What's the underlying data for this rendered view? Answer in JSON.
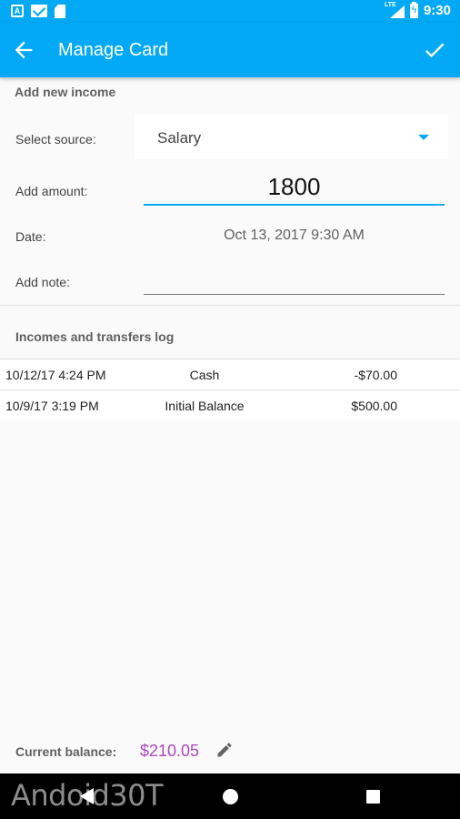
{
  "status_bar": {
    "time": "9:30",
    "network": "LTE",
    "left_icons": [
      "a-box-icon",
      "mail-icon",
      "sd-card-icon"
    ],
    "right_icons": [
      "signal-icon",
      "battery-charging-icon"
    ],
    "color": "#03a9f4"
  },
  "app_bar": {
    "title": "Manage Card",
    "back_icon": "arrow-back-icon",
    "confirm_icon": "check-icon",
    "color": "#03a9f4"
  },
  "income_form": {
    "header": "Add new income",
    "source_label": "Select source:",
    "source_value": "Salary",
    "amount_label": "Add amount:",
    "amount_value": "1800",
    "date_label": "Date:",
    "date_value": "Oct 13, 2017 9:30 AM",
    "note_label": "Add note:",
    "note_value": ""
  },
  "log": {
    "header": "Incomes and transfers log",
    "rows": [
      {
        "date": "10/12/17 4:24 PM",
        "source": "Cash",
        "amount": "-$70.00"
      },
      {
        "date": "10/9/17 3:19 PM",
        "source": "Initial Balance",
        "amount": "$500.00"
      }
    ]
  },
  "balance": {
    "label": "Current balance:",
    "value": "$210.05",
    "value_color": "#ab47bc",
    "edit_icon": "pencil-icon"
  },
  "nav_bar": {
    "icons": [
      "nav-back-icon",
      "nav-home-icon",
      "nav-recents-icon"
    ]
  },
  "watermark": {
    "text": "Andoid30T"
  }
}
